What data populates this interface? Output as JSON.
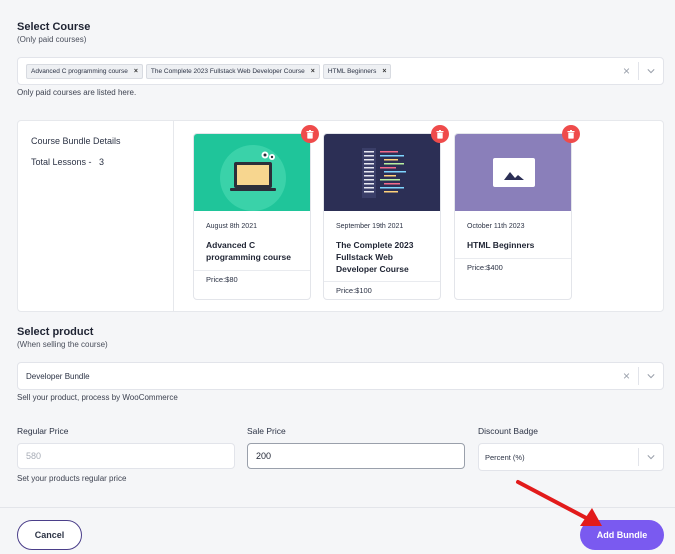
{
  "course_section": {
    "title": "Select Course",
    "subtitle": "(Only paid courses)",
    "selected_tags": [
      "Advanced C programming course",
      "The Complete 2023 Fullstack Web Developer Course",
      "HTML Beginners"
    ],
    "help": "Only paid courses are listed here."
  },
  "bundle_details": {
    "title": "Course Bundle Details",
    "lessons_label": "Total Lessons -",
    "lessons_count": "3",
    "cards": [
      {
        "date": "August 8th 2021",
        "title": "Advanced C programming course",
        "price": "Price:$80",
        "thumb_color": "#1fc59a"
      },
      {
        "date": "September 19th 2021",
        "title": "The Complete 2023 Fullstack Web Developer Course",
        "price": "Price:$100",
        "thumb_color": "#2c2f55"
      },
      {
        "date": "October 11th 2023",
        "title": "HTML Beginners",
        "price": "Price:$400",
        "thumb_color": "#8a7fba"
      }
    ]
  },
  "product_section": {
    "title": "Select product",
    "subtitle": "(When selling the course)",
    "selected": "Developer Bundle",
    "help": "Sell your product, process by WooCommerce"
  },
  "pricing": {
    "regular_label": "Regular Price",
    "regular_placeholder": "580",
    "regular_help": "Set your products regular price",
    "sale_label": "Sale Price",
    "sale_value": "200",
    "discount_label": "Discount Badge",
    "discount_value": "Percent (%)"
  },
  "footer": {
    "cancel_label": "Cancel",
    "submit_label": "Add Bundle"
  },
  "colors": {
    "accent": "#7a5af0",
    "delete": "#ef4b4b",
    "arrow": "#e21b1b"
  }
}
